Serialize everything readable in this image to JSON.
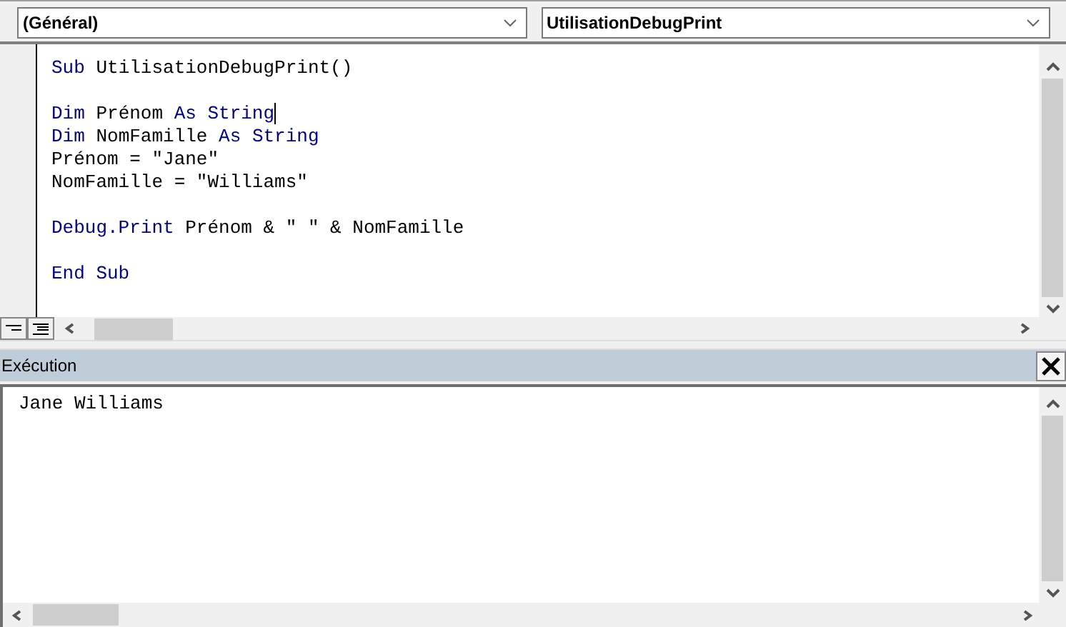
{
  "object_dropdown": {
    "value": "(Général)"
  },
  "procedure_dropdown": {
    "value": "UtilisationDebugPrint"
  },
  "code": {
    "blocks": [
      [
        {
          "caret": false,
          "tokens": [
            {
              "kind": "keyword",
              "text": "Sub "
            },
            {
              "kind": "plain",
              "text": "UtilisationDebugPrint()"
            }
          ]
        }
      ],
      [
        {
          "caret": true,
          "tokens": [
            {
              "kind": "keyword",
              "text": "Dim "
            },
            {
              "kind": "plain",
              "text": "Prénom "
            },
            {
              "kind": "keyword",
              "text": "As String"
            }
          ]
        },
        {
          "caret": false,
          "tokens": [
            {
              "kind": "keyword",
              "text": "Dim "
            },
            {
              "kind": "plain",
              "text": "NomFamille "
            },
            {
              "kind": "keyword",
              "text": "As String"
            }
          ]
        },
        {
          "caret": false,
          "tokens": [
            {
              "kind": "plain",
              "text": "Prénom = \"Jane\""
            }
          ]
        },
        {
          "caret": false,
          "tokens": [
            {
              "kind": "plain",
              "text": "NomFamille = \"Williams\""
            }
          ]
        }
      ],
      [
        {
          "caret": false,
          "tokens": [
            {
              "kind": "keyword",
              "text": "Debug.Print "
            },
            {
              "kind": "plain",
              "text": "Prénom & \" \" & NomFamille"
            }
          ]
        }
      ],
      [
        {
          "caret": false,
          "tokens": [
            {
              "kind": "keyword",
              "text": "End Sub"
            }
          ]
        }
      ]
    ]
  },
  "immediate": {
    "title": "Exécution",
    "output": [
      "Jane Williams"
    ]
  }
}
